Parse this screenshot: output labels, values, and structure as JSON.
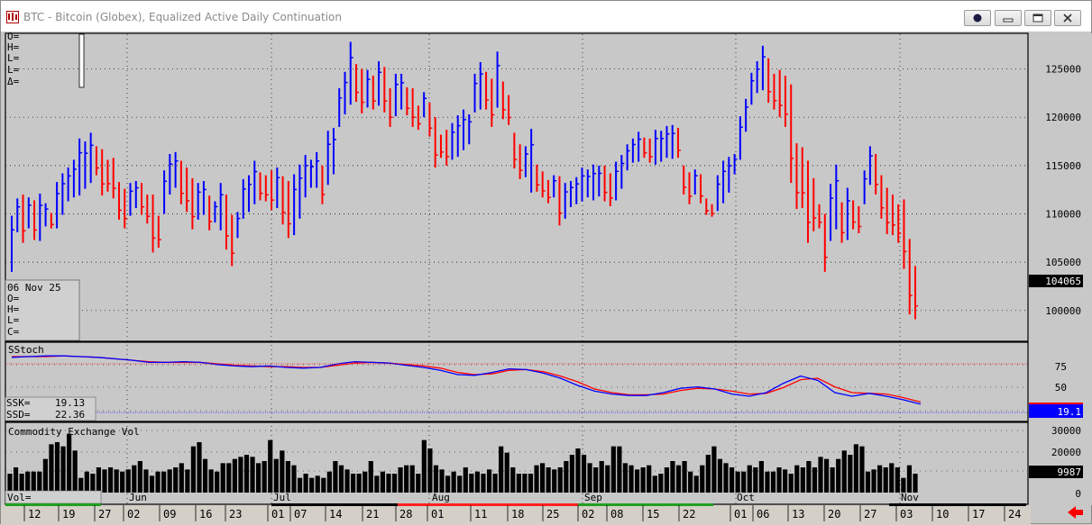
{
  "window": {
    "title": "BTC - Bitcoin (Globex), Equalized Active Daily Continuation"
  },
  "ohlc_panel": {
    "o": "O=",
    "h": "H=",
    "l": "L=",
    "l2": "L=",
    "d": "Δ="
  },
  "cursor_box": {
    "date": "06 Nov 25",
    "o": "O=",
    "h": "H=",
    "l": "L=",
    "c": "C="
  },
  "stoch_panel": {
    "label": "SStoch",
    "ssk_label": "SSK=",
    "ssk": "19.13",
    "ssd_label": "SSD=",
    "ssd": "22.36",
    "last_value": "19.1"
  },
  "volume_panel": {
    "label": "Commodity Exchange Vol",
    "vol_label": "Vol=",
    "last_value": "9987"
  },
  "price_last": "104065",
  "price_axis": [
    "125000",
    "120000",
    "115000",
    "110000",
    "105000",
    "100000"
  ],
  "stoch_axis": [
    "75",
    "50",
    "25"
  ],
  "vol_axis": [
    "30000",
    "20000",
    "10000",
    "0"
  ],
  "month_labels": [
    "Jun",
    "Jul",
    "Aug",
    "Sep",
    "Oct",
    "Nov"
  ],
  "day_labels": [
    "12",
    "19",
    "27",
    "02",
    "09",
    "16",
    "23",
    "01",
    "07",
    "14",
    "21",
    "28",
    "01",
    "11",
    "18",
    "25",
    "02",
    "08",
    "15",
    "22",
    "01",
    "06",
    "13",
    "20",
    "27",
    "03",
    "10",
    "17",
    "24"
  ],
  "colors": {
    "up": "#0000ff",
    "down": "#ff0000",
    "background": "#c8c8c8",
    "ssk": "#0000ff",
    "ssd": "#ff0000"
  },
  "chart_data": {
    "type": "bar",
    "title": "BTC - Bitcoin (Globex), Equalized Active Daily Continuation",
    "ylim": [
      97000,
      128500
    ],
    "price_bars": [
      [
        104000,
        109800,
        null
      ],
      [
        108100,
        111600,
        null
      ],
      [
        107000,
        112000,
        null
      ],
      [
        108500,
        111700,
        null
      ],
      [
        107300,
        111400,
        null
      ],
      [
        107200,
        112100,
        null
      ],
      [
        108700,
        111100,
        null
      ],
      [
        108500,
        110100,
        null
      ],
      [
        108500,
        113300,
        null
      ],
      [
        109900,
        114200,
        null
      ],
      [
        111300,
        114800,
        null
      ],
      [
        111700,
        115600,
        null
      ],
      [
        111900,
        117800,
        null
      ],
      [
        112600,
        117500,
        null
      ],
      [
        113200,
        118400,
        null
      ],
      [
        114000,
        117000,
        null
      ],
      [
        111900,
        116700,
        null
      ],
      [
        112300,
        115600,
        null
      ],
      [
        111600,
        115800,
        null
      ],
      [
        109400,
        113300,
        null
      ],
      [
        108500,
        112600,
        null
      ],
      [
        109800,
        113200,
        null
      ],
      [
        110600,
        113400,
        null
      ],
      [
        109900,
        113200,
        null
      ],
      [
        109000,
        112000,
        null
      ],
      [
        106000,
        112000,
        null
      ],
      [
        106500,
        109800,
        null
      ],
      [
        110000,
        114500,
        null
      ],
      [
        112000,
        116200,
        null
      ],
      [
        112700,
        116400,
        null
      ],
      [
        111000,
        115500,
        null
      ],
      [
        110200,
        114800,
        null
      ],
      [
        108400,
        113700,
        null
      ],
      [
        109400,
        113200,
        null
      ],
      [
        109900,
        113400,
        null
      ],
      [
        108300,
        111900,
        null
      ],
      [
        109100,
        111300,
        null
      ],
      [
        108300,
        113200,
        null
      ],
      [
        106300,
        112000,
        null
      ],
      [
        104600,
        109900,
        null
      ],
      [
        107500,
        110200,
        null
      ],
      [
        109500,
        113600,
        null
      ],
      [
        110200,
        114000,
        null
      ],
      [
        111000,
        115500,
        null
      ],
      [
        111400,
        114300,
        null
      ],
      [
        111300,
        114000,
        null
      ],
      [
        110400,
        114500,
        null
      ],
      [
        110600,
        114800,
        null
      ],
      [
        108900,
        113900,
        null
      ],
      [
        107500,
        113400,
        null
      ],
      [
        107800,
        114100,
        null
      ],
      [
        109500,
        115100,
        null
      ],
      [
        111700,
        116100,
        null
      ],
      [
        112700,
        115600,
        null
      ],
      [
        112700,
        116400,
        null
      ],
      [
        111000,
        115000,
        null
      ],
      [
        113000,
        118600,
        null
      ],
      [
        114100,
        118900,
        null
      ],
      [
        119000,
        123000,
        null
      ],
      [
        120300,
        124700,
        null
      ],
      [
        121300,
        127800,
        null
      ],
      [
        121600,
        125500,
        null
      ],
      [
        120400,
        125000,
        null
      ],
      [
        121000,
        124900,
        null
      ],
      [
        120800,
        124300,
        null
      ],
      [
        121200,
        125800,
        null
      ],
      [
        120500,
        125200,
        null
      ],
      [
        119000,
        123000,
        null
      ],
      [
        120100,
        124500,
        null
      ],
      [
        120800,
        124500,
        null
      ],
      [
        120200,
        123100,
        null
      ],
      [
        119000,
        123000,
        null
      ],
      [
        118700,
        121200,
        null
      ],
      [
        120000,
        122600,
        null
      ],
      [
        118000,
        121500,
        null
      ],
      [
        114800,
        120000,
        null
      ],
      [
        115800,
        118200,
        null
      ],
      [
        115000,
        118700,
        null
      ],
      [
        115600,
        119400,
        null
      ],
      [
        115900,
        120200,
        null
      ],
      [
        116600,
        120800,
        null
      ],
      [
        117200,
        120300,
        null
      ],
      [
        120500,
        124500,
        null
      ],
      [
        120800,
        125700,
        null
      ],
      [
        120800,
        124700,
        null
      ],
      [
        119000,
        124000,
        null
      ],
      [
        121000,
        126800,
        null
      ],
      [
        119800,
        123700,
        null
      ],
      [
        119200,
        122300,
        null
      ],
      [
        114700,
        118400,
        null
      ],
      [
        113600,
        117200,
        null
      ],
      [
        113800,
        117000,
        null
      ],
      [
        112200,
        118800,
        null
      ],
      [
        112300,
        115100,
        null
      ],
      [
        111700,
        114400,
        null
      ],
      [
        111100,
        113500,
        null
      ],
      [
        111700,
        114000,
        null
      ],
      [
        108800,
        113900,
        null
      ],
      [
        109500,
        113200,
        null
      ],
      [
        110700,
        113400,
        null
      ],
      [
        111000,
        113800,
        null
      ],
      [
        111300,
        114800,
        null
      ],
      [
        111700,
        114600,
        null
      ],
      [
        111400,
        115100,
        null
      ],
      [
        111800,
        115000,
        null
      ],
      [
        111300,
        115000,
        null
      ],
      [
        110800,
        114200,
        null
      ],
      [
        111400,
        115400,
        null
      ],
      [
        112600,
        116100,
        null
      ],
      [
        114500,
        117200,
        null
      ],
      [
        115300,
        117800,
        null
      ],
      [
        115400,
        118500,
        null
      ],
      [
        115800,
        117900,
        null
      ],
      [
        115300,
        117800,
        null
      ],
      [
        115100,
        118700,
        null
      ],
      [
        115400,
        118600,
        null
      ],
      [
        115800,
        119100,
        null
      ],
      [
        115700,
        119200,
        null
      ],
      [
        115800,
        118900,
        null
      ],
      [
        112000,
        115000,
        null
      ],
      [
        111000,
        114300,
        null
      ],
      [
        112000,
        114600,
        null
      ],
      [
        111100,
        114100,
        null
      ],
      [
        109900,
        111600,
        null
      ],
      [
        109700,
        111000,
        null
      ],
      [
        110300,
        114000,
        null
      ],
      [
        111100,
        115500,
        null
      ],
      [
        112200,
        115900,
        null
      ],
      [
        114100,
        116200,
        null
      ],
      [
        115600,
        120100,
        null
      ],
      [
        118500,
        121900,
        null
      ],
      [
        121300,
        124600,
        null
      ],
      [
        122500,
        125800,
        null
      ],
      [
        122800,
        127400,
        null
      ],
      [
        121500,
        126100,
        null
      ],
      [
        120800,
        124500,
        null
      ],
      [
        120000,
        124900,
        null
      ],
      [
        119000,
        124300,
        null
      ],
      [
        113200,
        123400,
        null
      ],
      [
        110500,
        117300,
        null
      ],
      [
        110600,
        116900,
        null
      ],
      [
        107000,
        115500,
        null
      ],
      [
        108200,
        113700,
        null
      ],
      [
        108500,
        111000,
        null
      ],
      [
        104000,
        110000,
        null
      ],
      [
        107200,
        113100,
        null
      ],
      [
        108400,
        115100,
        null
      ],
      [
        107000,
        111200,
        null
      ],
      [
        107300,
        112700,
        null
      ],
      [
        108400,
        111400,
        null
      ],
      [
        108000,
        110800,
        null
      ],
      [
        111000,
        114500,
        null
      ],
      [
        113000,
        117000,
        null
      ],
      [
        112000,
        116200,
        null
      ],
      [
        109500,
        114000,
        null
      ],
      [
        107900,
        112700,
        null
      ],
      [
        107800,
        112000,
        null
      ],
      [
        107000,
        111000,
        null
      ],
      [
        104300,
        111500,
        null
      ],
      [
        99600,
        107400,
        null
      ],
      [
        99100,
        104600,
        null
      ]
    ],
    "ssk": [
      84,
      85,
      86,
      86,
      85,
      84,
      82,
      80,
      77,
      77,
      78,
      77,
      74,
      72,
      71,
      72,
      70,
      69,
      70,
      75,
      78,
      77,
      76,
      73,
      70,
      66,
      60,
      59,
      63,
      68,
      67,
      62,
      55,
      45,
      37,
      33,
      31,
      31,
      35,
      41,
      43,
      40,
      33,
      30,
      35,
      48,
      58,
      52,
      35,
      30,
      34,
      30,
      25,
      19
    ],
    "ssd": [
      85,
      85,
      85,
      86,
      85,
      84,
      82,
      80,
      78,
      77,
      77,
      77,
      75,
      73,
      72,
      71,
      71,
      70,
      70,
      73,
      76,
      77,
      76,
      74,
      72,
      69,
      63,
      60,
      61,
      66,
      67,
      64,
      58,
      50,
      40,
      35,
      32,
      32,
      33,
      38,
      41,
      40,
      37,
      33,
      34,
      42,
      53,
      55,
      43,
      35,
      34,
      33,
      28,
      22
    ],
    "volume": [
      9,
      12,
      9,
      10,
      10,
      10,
      16,
      23,
      24,
      22,
      28,
      20,
      7,
      10,
      9,
      12,
      11,
      12,
      11,
      10,
      11,
      13,
      15,
      11,
      8,
      10,
      10,
      11,
      12,
      14,
      11,
      22,
      24,
      16,
      11,
      10,
      14,
      14,
      16,
      17,
      18,
      17,
      14,
      15,
      25,
      16,
      20,
      15,
      13,
      7,
      9,
      7,
      8,
      7,
      10,
      15,
      13,
      11,
      9,
      9,
      10,
      15,
      8,
      10,
      9,
      9,
      12,
      13,
      13,
      9,
      25,
      21,
      13,
      11,
      8,
      10,
      8,
      12,
      9,
      10,
      9,
      11,
      9,
      22,
      19,
      12,
      9,
      9,
      9,
      13,
      14,
      12,
      11,
      12,
      15,
      18,
      21,
      18,
      14,
      12,
      15,
      13,
      22,
      22,
      14,
      13,
      11,
      12,
      13,
      8,
      9,
      12,
      15,
      13,
      15,
      10,
      8,
      13,
      18,
      22,
      16,
      14,
      12,
      10,
      10,
      13,
      12,
      15,
      10,
      10,
      12,
      11,
      9,
      13,
      12,
      15,
      12,
      17,
      16,
      12,
      16,
      20,
      18,
      23,
      22,
      10,
      11,
      13,
      12,
      14,
      12,
      7,
      13,
      9
    ]
  }
}
